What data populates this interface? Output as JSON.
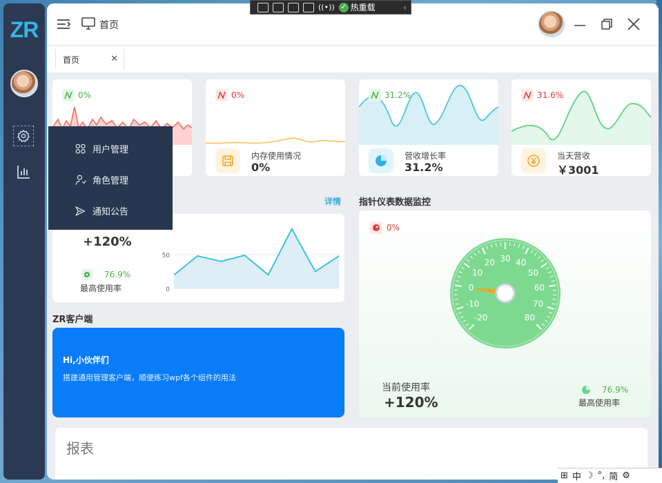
{
  "debug_toolbar": {
    "hot_reload_label": "热重载"
  },
  "sidebar": {
    "logo": "ZR",
    "menu": [
      {
        "label": "用户管理",
        "icon": "users-icon"
      },
      {
        "label": "角色管理",
        "icon": "role-icon"
      },
      {
        "label": "通知公告",
        "icon": "megaphone-icon"
      }
    ]
  },
  "header": {
    "title": "首页"
  },
  "tabs": [
    {
      "label": "首页"
    }
  ],
  "stats": [
    {
      "trend": "0%",
      "trend_color": "#4caf50",
      "label": "",
      "value": ""
    },
    {
      "trend": "0%",
      "trend_color": "#e53935",
      "label": "内存使用情况",
      "value": "0%"
    },
    {
      "trend": "31.2%",
      "trend_color": "#4caf50",
      "label": "营收增长率",
      "value": "31.2%"
    },
    {
      "trend": "31.6%",
      "trend_color": "#e53935",
      "label": "当天营收",
      "value": "￥3001"
    }
  ],
  "usage_panel": {
    "detail_link": "详情",
    "current_value": "+120%",
    "max_rate": "76.9%",
    "max_label": "最高使用率",
    "y_ticks": [
      "50",
      "0"
    ]
  },
  "usage_chart_data": {
    "type": "area",
    "values": [
      20,
      48,
      40,
      49,
      20,
      88,
      25,
      48
    ],
    "ylim": [
      0,
      100
    ]
  },
  "gauge_panel": {
    "title": "指针仪表数据监控",
    "badge": "0%",
    "ticks": [
      "-20",
      "-10",
      "0",
      "10",
      "20",
      "30",
      "40",
      "50",
      "60",
      "70",
      "80"
    ],
    "current_label": "当前使用率",
    "current_value": "+120%",
    "max_rate": "76.9%",
    "max_label": "最高使用率"
  },
  "client_panel": {
    "title": "ZR客户端",
    "greeting": "Hi,小伙伴们",
    "description": "搭建通用管理客户端，顺便练习wpf各个组件的用法"
  },
  "report": {
    "title": "报表"
  },
  "ime": {
    "items": [
      "中",
      "简"
    ]
  }
}
